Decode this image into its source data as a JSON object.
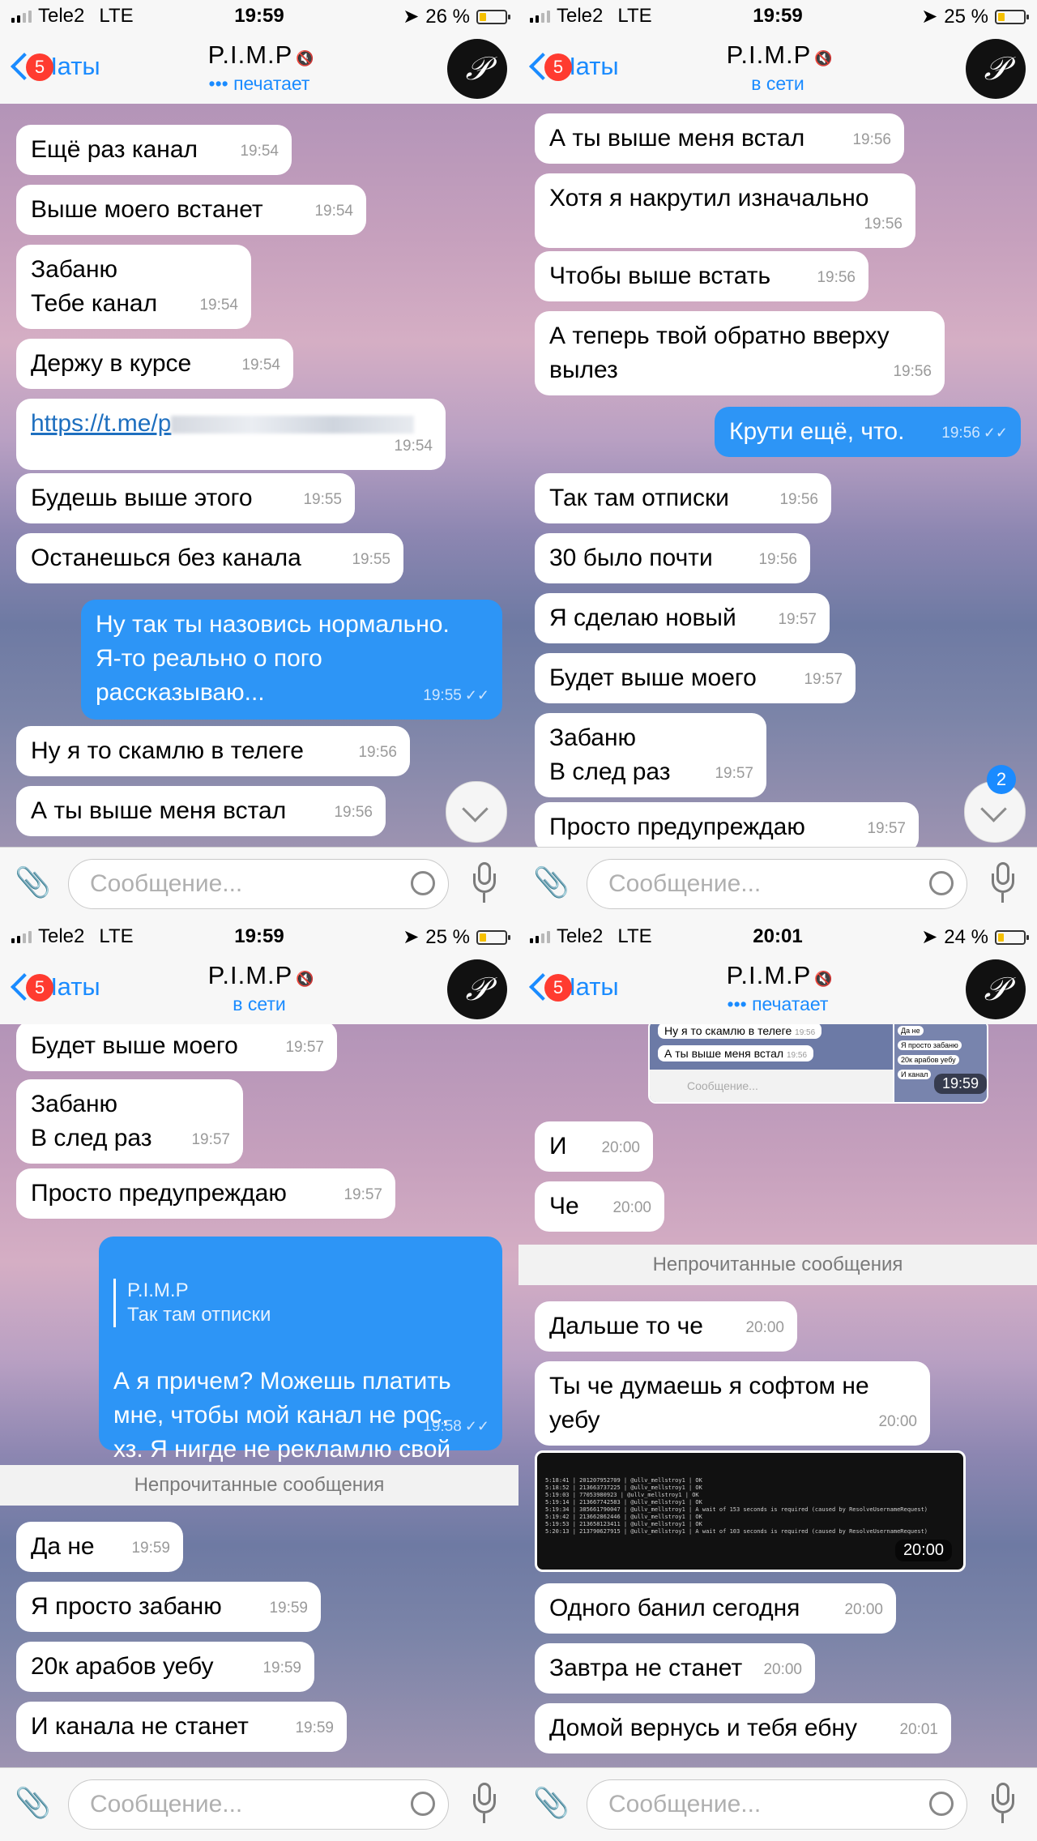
{
  "screens": [
    {
      "status": {
        "carrier": "Tele2",
        "network": "LTE",
        "time": "19:59",
        "battery": "26 %",
        "battery_level": 0.26
      },
      "nav": {
        "back": "Чаты",
        "badge": "5",
        "title": "P.I.M.P",
        "subtitle": "••• печатает"
      },
      "messages": [
        {
          "text": "Ещё раз канал",
          "time": "19:54"
        },
        {
          "text": "Выше моего встанет",
          "time": "19:54"
        },
        {
          "text": "Забаню\nТебе канал",
          "time": "19:54"
        },
        {
          "text": "Держу в курсе",
          "time": "19:54"
        },
        {
          "text": "https://t.me/p",
          "time": "19:54"
        },
        {
          "text": "Будешь выше этого",
          "time": "19:55"
        },
        {
          "text": "Останешься без канала",
          "time": "19:55"
        },
        {
          "text": "Ну так ты назовись нормально.\nЯ-то реально о пого\nрассказываю...",
          "time": "19:55"
        },
        {
          "text": "Ну я то скамлю в телеге",
          "time": "19:56"
        },
        {
          "text": "А ты выше меня встал",
          "time": "19:56"
        }
      ],
      "input_placeholder": "Сообщение..."
    },
    {
      "status": {
        "carrier": "Tele2",
        "network": "LTE",
        "time": "19:59",
        "battery": "25 %",
        "battery_level": 0.25
      },
      "nav": {
        "back": "Чаты",
        "badge": "5",
        "title": "P.I.M.P",
        "subtitle": "в сети"
      },
      "messages": [
        {
          "text": "А ты выше меня встал",
          "time": "19:56"
        },
        {
          "text": "Хотя я накрутил изначально",
          "time": "19:56"
        },
        {
          "text": "Чтобы выше встать",
          "time": "19:56"
        },
        {
          "text": "А теперь твой обратно вверху\nвылез",
          "time": "19:56"
        },
        {
          "text": "Крути ещё, что.",
          "time": "19:56"
        },
        {
          "text": "Так там отписки",
          "time": "19:56"
        },
        {
          "text": "30 было почти",
          "time": "19:56"
        },
        {
          "text": "Я сделаю новый",
          "time": "19:57"
        },
        {
          "text": "Будет выше моего",
          "time": "19:57"
        },
        {
          "text": "Забаню\nВ след раз",
          "time": "19:57"
        },
        {
          "text": "Просто предупреждаю",
          "time": "19:57"
        }
      ],
      "unread_badge": "2",
      "input_placeholder": "Сообщение..."
    },
    {
      "status": {
        "carrier": "Tele2",
        "network": "LTE",
        "time": "19:59",
        "battery": "25 %",
        "battery_level": 0.25
      },
      "nav": {
        "back": "Чаты",
        "badge": "5",
        "title": "P.I.M.P",
        "subtitle": "в сети"
      },
      "messages": [
        {
          "text": "Будет выше моего",
          "time": "19:57"
        },
        {
          "text": "Забаню\nВ след раз",
          "time": "19:57"
        },
        {
          "text": "Просто предупреждаю",
          "time": "19:57"
        },
        {
          "reply_name": "P.I.M.P",
          "reply_text": "Так там отписки",
          "text": "А я причем? Можешь платить\nмне, чтобы мой канал не рос,\nхз. Я нигде не рекламлю свой\nканал.",
          "time": "19:58"
        },
        {
          "text": "Да не",
          "time": "19:59"
        },
        {
          "text": "Я просто забаню",
          "time": "19:59"
        },
        {
          "text": "20к арабов уебу",
          "time": "19:59"
        },
        {
          "text": "И канала не станет",
          "time": "19:59"
        }
      ],
      "divider": "Непрочитанные сообщения",
      "input_placeholder": "Сообщение..."
    },
    {
      "status": {
        "carrier": "Tele2",
        "network": "LTE",
        "time": "20:01",
        "battery": "24 %",
        "battery_level": 0.24
      },
      "nav": {
        "back": "Чаты",
        "badge": "5",
        "title": "P.I.M.P",
        "subtitle": "••• печатает"
      },
      "screenshot_preview": {
        "line1": "Ну я то скамлю в телеге",
        "line1_time": "19:56",
        "line2": "А ты выше меня встал",
        "line2_time": "19:56",
        "input": "Сообщение...",
        "mini1": "Да не",
        "mini2": "Я просто забаню",
        "mini3": "20к арабов уебу",
        "mini4": "И канал",
        "time": "19:59"
      },
      "messages": [
        {
          "text": "И",
          "time": "20:00"
        },
        {
          "text": "Че",
          "time": "20:00"
        },
        {
          "text": "Дальше то че",
          "time": "20:00"
        },
        {
          "text": "Ты че думаешь я софтом не\nуебу",
          "time": "20:00"
        },
        {
          "text": "Одного банил сегодня",
          "time": "20:00"
        },
        {
          "text": "Завтра не станет",
          "time": "20:00"
        },
        {
          "text": "Домой вернусь и тебя ебну",
          "time": "20:01"
        }
      ],
      "terminal_lines": [
        "5:18:41 | 201207952709 | @ullv_mellstroy1 | OK",
        "5:18:52 | 213663737225 | @ullv_mellstroy1 | OK",
        "5:19:03 | 77053980923  | @ullv_mellstroy1 | OK",
        "5:19:14 | 213667742583 | @ullv_mellstroy1 | OK",
        "5:19:34 | 385661790047 | @ullv_mellstroy1 | A wait of 153 seconds is required (caused by ResolveUsernameRequest)",
        "5:19:42 | 213662862446 | @ullv_mellstroy1 | OK",
        "5:19:53 | 213658123411 | @ullv_mellstroy1 | OK",
        "5:20:13 | 213790627915 | @ullv_mellstroy1 | A wait of 103 seconds is required (caused by ResolveUsernameRequest)"
      ],
      "photo_time": "20:00",
      "divider": "Непрочитанные сообщения",
      "input_placeholder": "Сообщение..."
    }
  ]
}
